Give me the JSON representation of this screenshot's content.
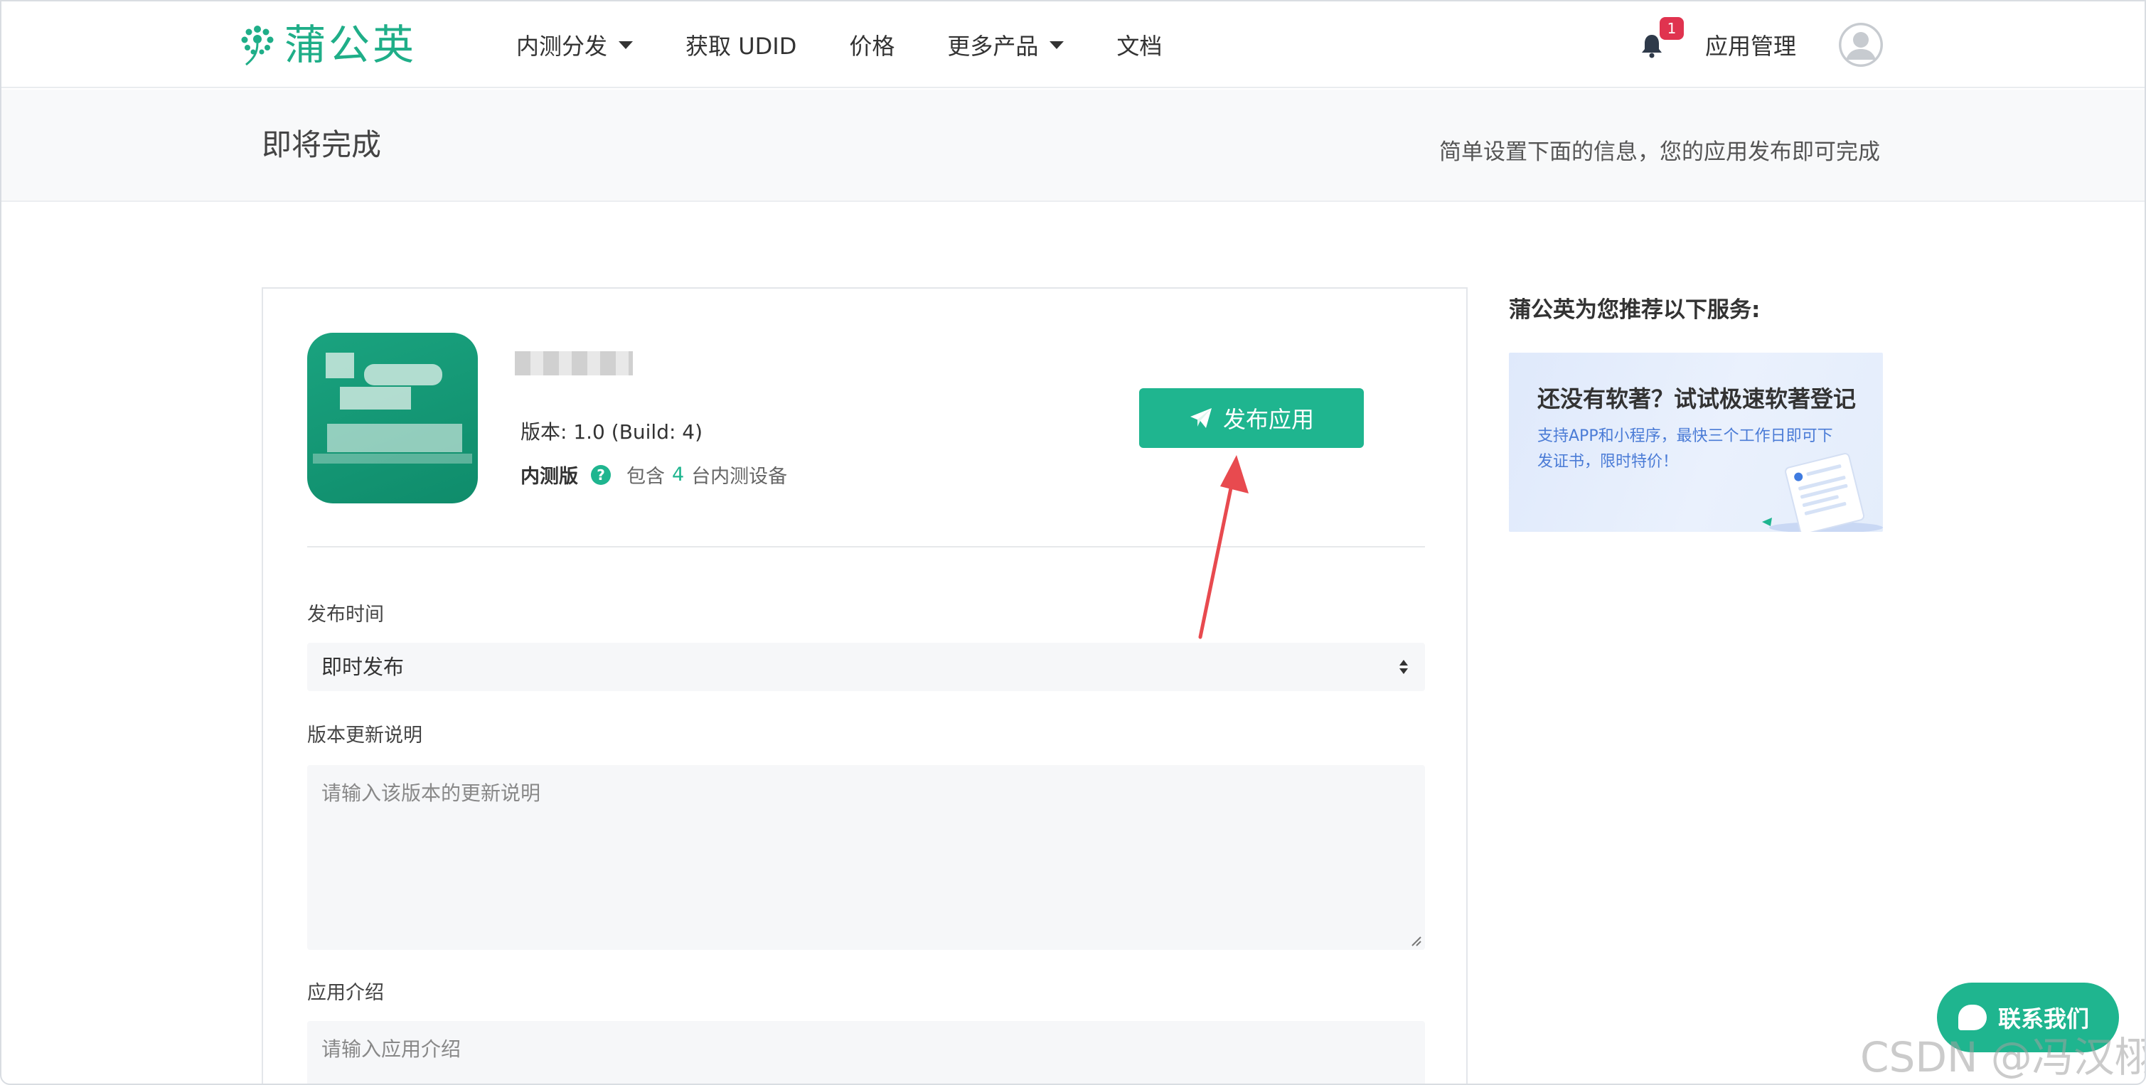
{
  "brand": {
    "name": "蒲公英",
    "color": "#1fae88"
  },
  "nav": {
    "items": [
      {
        "label": "内测分发",
        "has_dropdown": true
      },
      {
        "label": "获取 UDID",
        "has_dropdown": false
      },
      {
        "label": "价格",
        "has_dropdown": false
      },
      {
        "label": "更多产品",
        "has_dropdown": true
      },
      {
        "label": "文档",
        "has_dropdown": false
      }
    ],
    "notification_count": "1",
    "app_management": "应用管理"
  },
  "subheader": {
    "title": "即将完成",
    "hint": "简单设置下面的信息，您的应用发布即可完成"
  },
  "app": {
    "version": "版本: 1.0 (Build: 4)",
    "channel": "内测版",
    "devices_prefix": "包含",
    "devices_count": "4",
    "devices_suffix": "台内测设备"
  },
  "publish_button": "发布应用",
  "form": {
    "publish_time_label": "发布时间",
    "publish_time_value": "即时发布",
    "update_notes_label": "版本更新说明",
    "update_notes_placeholder": "请输入该版本的更新说明",
    "intro_label": "应用介绍",
    "intro_placeholder": "请输入应用介绍"
  },
  "sidebar": {
    "title": "蒲公英为您推荐以下服务:",
    "promo_title": "还没有软著？试试极速软著登记",
    "promo_sub": "支持APP和小程序，最快三个工作日即可下发证书，限时特价！"
  },
  "contact_button": "联系我们",
  "watermark": "CSDN @冯汉栩",
  "colors": {
    "accent": "#1fb58f",
    "badge": "#e0334f",
    "arrow": "#e84a4f"
  }
}
